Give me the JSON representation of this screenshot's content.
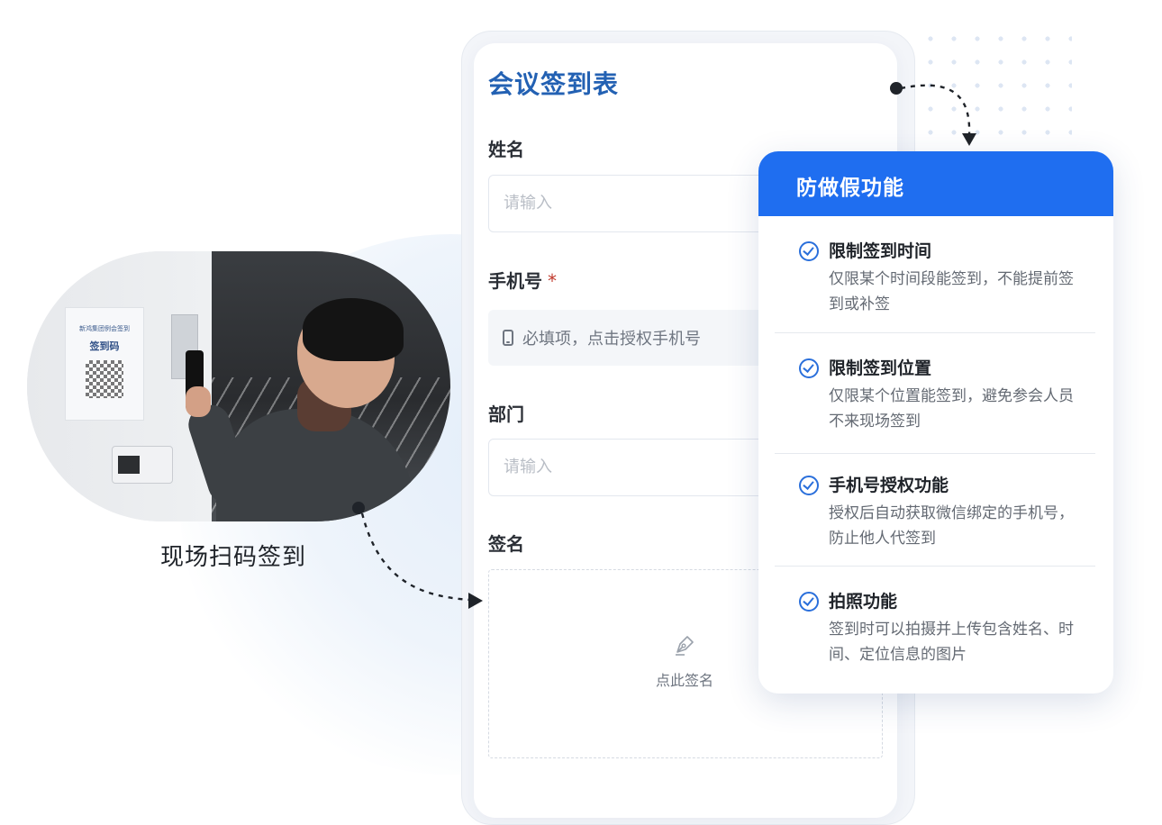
{
  "form": {
    "title": "会议签到表",
    "fields": {
      "name_label": "姓名",
      "name_placeholder": "请输入",
      "phone_label": "手机号",
      "phone_required_mark": "*",
      "phone_hint": "必填项，点击授权手机号",
      "dept_label": "部门",
      "dept_placeholder": "请输入",
      "signature_label": "签名",
      "signature_hint": "点此签名"
    }
  },
  "photo": {
    "caption": "现场扫码签到",
    "poster_header": "新鸿集团例会签到",
    "poster_title": "签到码"
  },
  "anti_fake": {
    "title": "防做假功能",
    "items": [
      {
        "title": "限制签到时间",
        "desc": "仅限某个时间段能签到，不能提前签到或补签"
      },
      {
        "title": "限制签到位置",
        "desc": "仅限某个位置能签到，避免参会人员不来现场签到"
      },
      {
        "title": "手机号授权功能",
        "desc": "授权后自动获取微信绑定的手机号，防止他人代签到"
      },
      {
        "title": "拍照功能",
        "desc": "签到时可以拍摄并上传包含姓名、时间、定位信息的图片"
      }
    ]
  },
  "icons": {
    "check": "check-circle-icon",
    "mobile": "mobile-phone-icon",
    "pen": "pen-nib-icon"
  },
  "colors": {
    "accent": "#1f6ef0",
    "title_blue": "#2361b3",
    "required": "#c0392b"
  }
}
